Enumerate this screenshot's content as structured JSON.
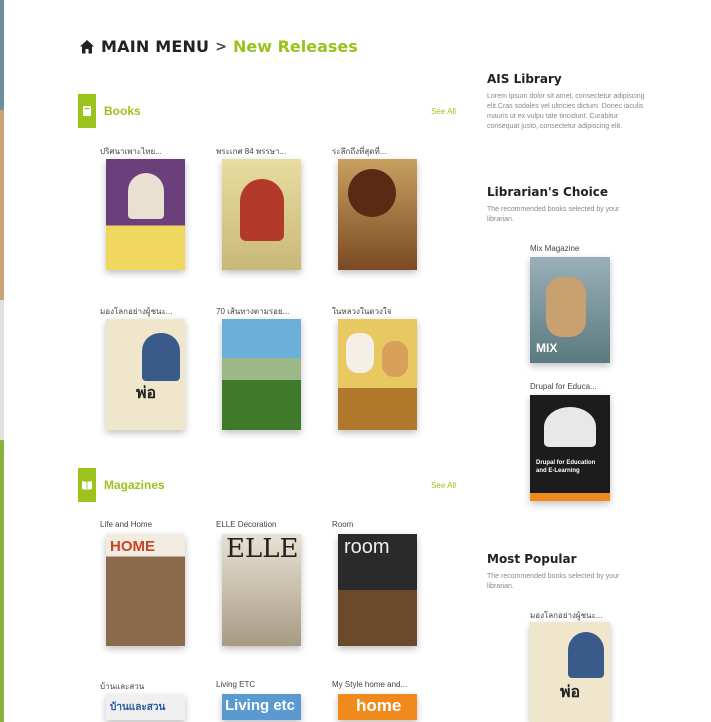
{
  "breadcrumb": {
    "main": "MAIN MENU",
    "separator": ">",
    "current": "New Releases"
  },
  "books": {
    "title": "Books",
    "see_all": "See All",
    "items": [
      {
        "name": "ปริศนาเพาะไทย...",
        "cover_color": "#6a3f7a"
      },
      {
        "name": "พระเกศ 84 พรรษา...",
        "cover_color": "#d9c98a"
      },
      {
        "name": "ระลึกถึงที่สุดที่...",
        "cover_color": "#7a4a24"
      },
      {
        "name": "มองโลกอย่างผู้ชนะ...",
        "cover_color": "#e8d8b0"
      },
      {
        "name": "70 เส้นทางตามรอย...",
        "cover_color": "#4f7a3a"
      },
      {
        "name": "ในหลวงในดวงใจ",
        "cover_color": "#b0782a"
      }
    ]
  },
  "magazines": {
    "title": "Magazines",
    "see_all": "See All",
    "items": [
      {
        "name": "Life and Home",
        "masthead": "HOME",
        "cover_color": "#8a6a4a"
      },
      {
        "name": "ELLE Decoration",
        "masthead": "ELLE",
        "cover_color": "#c8bfae"
      },
      {
        "name": "Room",
        "masthead": "room",
        "cover_color": "#3a3a3a"
      },
      {
        "name": "บ้านและสวน",
        "masthead": "บ้านและสวน",
        "cover_color": "#e6e6e6"
      },
      {
        "name": "Living ETC",
        "masthead": "Living etc",
        "cover_color": "#5a9ad0"
      },
      {
        "name": "My Style home and...",
        "masthead": "home",
        "cover_color": "#f08a1c"
      }
    ]
  },
  "sidebar": {
    "library": {
      "title": "AIS Library",
      "text": "Lorem ipsum dolor sit amet, consectetur adipiscing elit.Cras sodales vel ultricies dictum. Donec iaculis mauris ut ex vulpu tate tincidunt. Curabitur consequat justo, consectetur adipiscing elit."
    },
    "librarians_choice": {
      "title": "Librarian's Choice",
      "text": "The recommended books selected by your librarian.",
      "items": [
        {
          "name": "Mix Magazine",
          "cover_color": "#7a9aa4"
        },
        {
          "name": "Drupal for Educa...",
          "cover_color": "#1c1c1c"
        }
      ]
    },
    "most_popular": {
      "title": "Most Popular",
      "text": "The recommended books selected by your librarian.",
      "items": [
        {
          "name": "มองโลกอย่างผู้ชนะ...",
          "cover_color": "#e8d8b0"
        }
      ]
    }
  }
}
